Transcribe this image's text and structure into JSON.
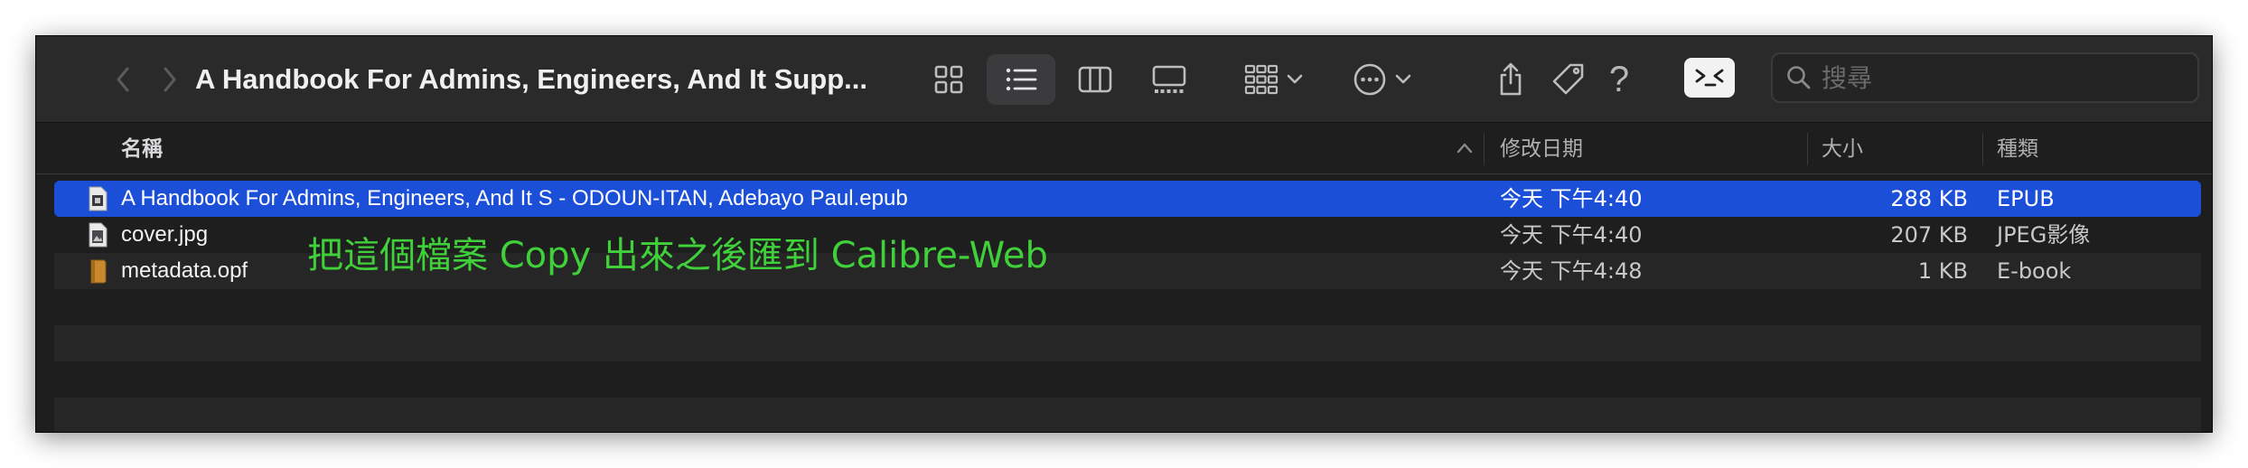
{
  "toolbar": {
    "title": "A Handbook For Admins, Engineers, And It Supp...",
    "search_placeholder": "搜尋"
  },
  "columns": {
    "name": "名稱",
    "date": "修改日期",
    "size": "大小",
    "kind": "種類"
  },
  "files": [
    {
      "name": "A Handbook For Admins, Engineers, And It S - ODOUN-ITAN, Adebayo Paul.epub",
      "date": "今天 下午4:40",
      "size": "288 KB",
      "kind": "EPUB",
      "icon": "epub-file-icon",
      "selected": true
    },
    {
      "name": "cover.jpg",
      "date": "今天 下午4:40",
      "size": "207 KB",
      "kind": "JPEG影像",
      "icon": "image-file-icon",
      "selected": false
    },
    {
      "name": "metadata.opf",
      "date": "今天 下午4:48",
      "size": "1 KB",
      "kind": "E-book",
      "icon": "opf-file-icon",
      "selected": false
    }
  ],
  "annotation": "把這個檔案 Copy 出來之後匯到 Calibre-Web",
  "colors": {
    "selection": "#1b4fd8",
    "annotation": "#3fd03a",
    "window_bg": "#1e1e1f"
  }
}
